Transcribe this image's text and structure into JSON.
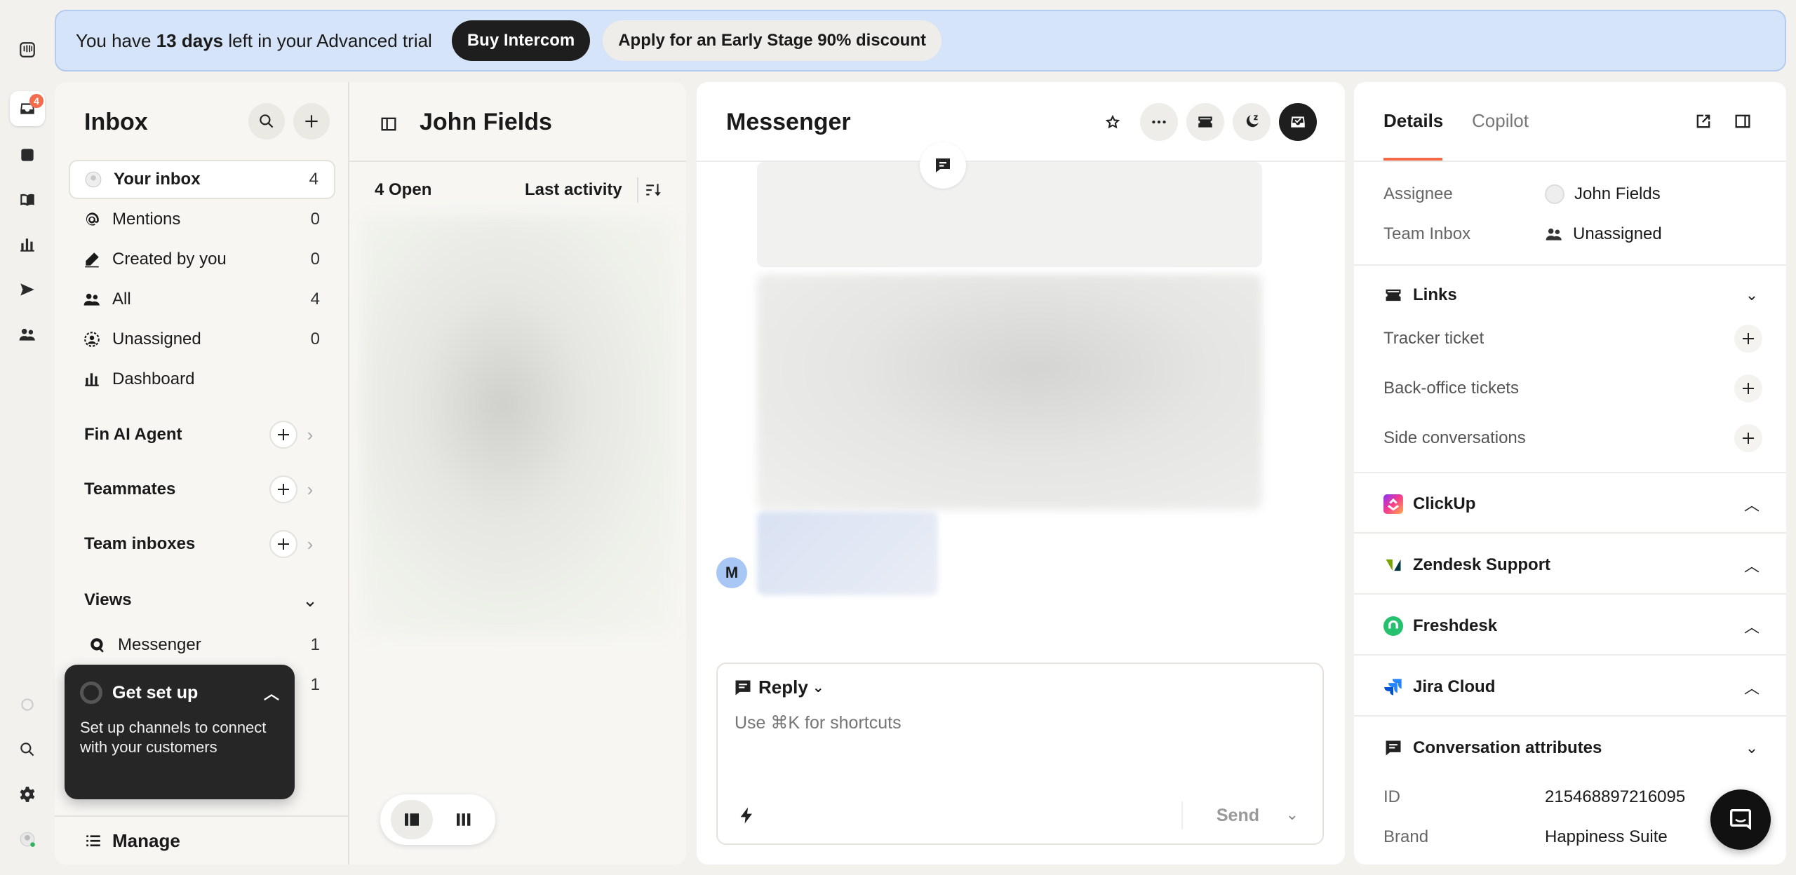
{
  "rail": {
    "inbox_badge": "4"
  },
  "banner": {
    "text_prefix": "You have ",
    "days": "13 days",
    "text_suffix": " left in your Advanced trial",
    "buy_label": "Buy Intercom",
    "discount_label": "Apply for an Early Stage 90% discount"
  },
  "inbox": {
    "title": "Inbox",
    "items": [
      {
        "label": "Your inbox",
        "count": "4"
      },
      {
        "label": "Mentions",
        "count": "0"
      },
      {
        "label": "Created by you",
        "count": "0"
      },
      {
        "label": "All",
        "count": "4"
      },
      {
        "label": "Unassigned",
        "count": "0"
      },
      {
        "label": "Dashboard",
        "count": ""
      }
    ],
    "sections": [
      {
        "label": "Fin AI Agent"
      },
      {
        "label": "Teammates"
      },
      {
        "label": "Team inboxes"
      }
    ],
    "views": {
      "label": "Views",
      "items": [
        {
          "label": "Messenger",
          "count": "1"
        },
        {
          "label": "",
          "count": "1"
        }
      ]
    },
    "manage_label": "Manage"
  },
  "setup": {
    "title": "Get set up",
    "body": "Set up channels to connect with your customers"
  },
  "list": {
    "title": "John Fields",
    "open_label": "4 Open",
    "sort_label": "Last activity"
  },
  "conversation": {
    "title": "Messenger",
    "avatar_initial": "M",
    "composer": {
      "mode_label": "Reply",
      "placeholder": "Use ⌘K for shortcuts",
      "send_label": "Send"
    }
  },
  "details": {
    "tab_details": "Details",
    "tab_copilot": "Copilot",
    "assignee_label": "Assignee",
    "assignee_value": "John Fields",
    "team_label": "Team Inbox",
    "team_value": "Unassigned",
    "links_label": "Links",
    "links": [
      {
        "label": "Tracker ticket"
      },
      {
        "label": "Back-office tickets"
      },
      {
        "label": "Side conversations"
      }
    ],
    "integrations": [
      {
        "label": "ClickUp"
      },
      {
        "label": "Zendesk Support"
      },
      {
        "label": "Freshdesk"
      },
      {
        "label": "Jira Cloud"
      }
    ],
    "attributes_label": "Conversation attributes",
    "attributes": [
      {
        "key": "ID",
        "value": "215468897216095"
      },
      {
        "key": "Brand",
        "value": "Happiness Suite"
      }
    ]
  }
}
